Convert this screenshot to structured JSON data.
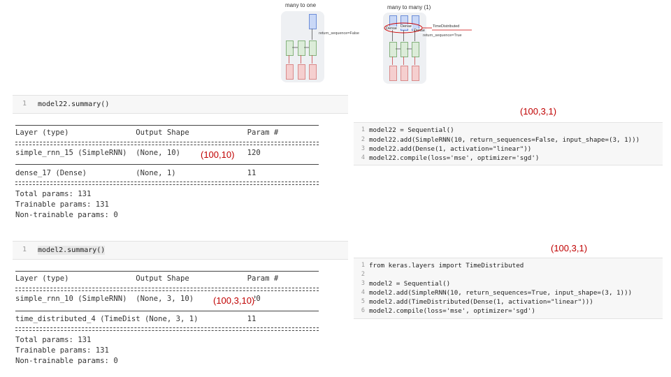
{
  "diagram_left": {
    "title": "many to one",
    "annotation": "return_sequence=False"
  },
  "diagram_right": {
    "title": "many to many (1)",
    "dense_labels": [
      "Dense",
      "Dense",
      "Dense"
    ],
    "annotation_top": "TimeDistributed",
    "annotation_bottom": "return_sequence=True"
  },
  "cell_top_left": {
    "line_number": "1",
    "code": "model22.summary()"
  },
  "summary_1": {
    "header": "Layer (type)               Output Shape             Param #",
    "row1": "simple_rnn_15 (SimpleRNN)  (None, 10)               120",
    "row2": "dense_17 (Dense)           (None, 1)                11",
    "total": "Total params: 131",
    "trainable": "Trainable params: 131",
    "non_trainable": "Non-trainable params: 0",
    "note": "(100,10)"
  },
  "note_top_right": "(100,3,1)",
  "cell_right_1": {
    "line_numbers": [
      "1",
      "2",
      "3",
      "4"
    ],
    "lines": [
      "model22 = Sequential()",
      "model22.add(SimpleRNN(10, return_sequences=False, input_shape=(3, 1)))",
      "model22.add(Dense(1, activation=\"linear\"))",
      "model22.compile(loss='mse', optimizer='sgd')"
    ]
  },
  "cell_mid_left": {
    "line_number": "1",
    "code": "model2.summary()"
  },
  "note_mid_right": "(100,3,1)",
  "cell_right_2": {
    "line_numbers": [
      "1",
      "2",
      "3",
      "4",
      "5",
      "6"
    ],
    "lines": [
      "from keras.layers import TimeDistributed",
      "",
      "model2 = Sequential()",
      "model2.add(SimpleRNN(10, return_sequences=True, input_shape=(3, 1)))",
      "model2.add(TimeDistributed(Dense(1, activation=\"linear\")))",
      "model2.compile(loss='mse', optimizer='sgd')"
    ]
  },
  "summary_2": {
    "header": "Layer (type)               Output Shape             Param #",
    "row1": "simple_rnn_10 (SimpleRNN)  (None, 3, 10)            120",
    "row2": "time_distributed_4 (TimeDist (None, 3, 1)           11",
    "total": "Total params: 131",
    "trainable": "Trainable params: 131",
    "non_trainable": "Non-trainable params: 0",
    "note": "(100,3,10)"
  }
}
